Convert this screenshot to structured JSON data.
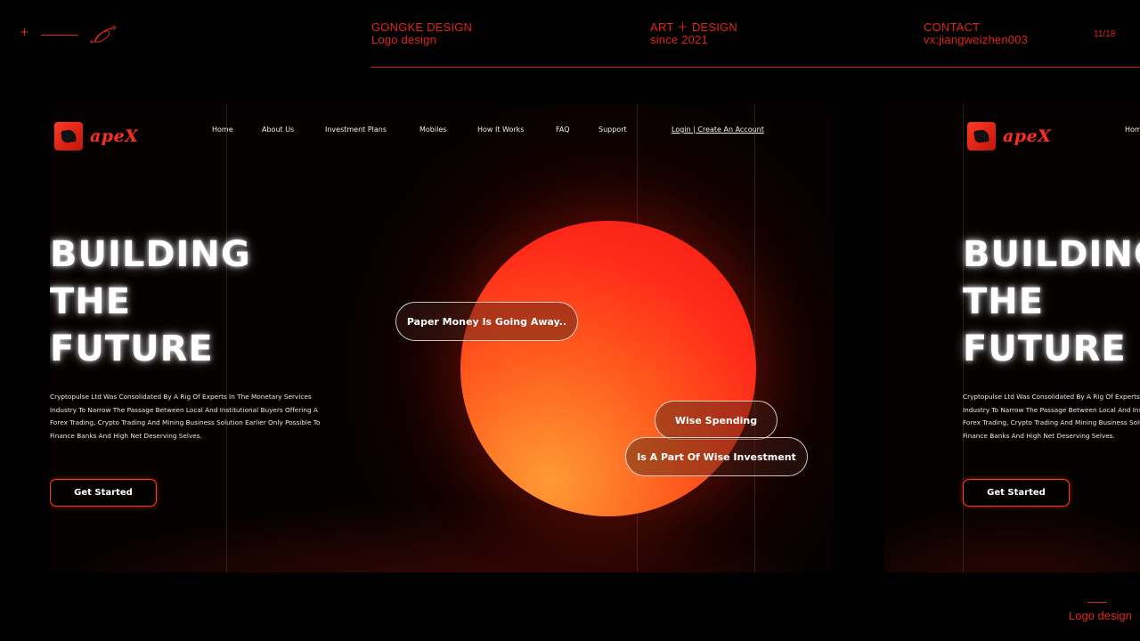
{
  "frame": {
    "col1": {
      "title": "GONGKE DESIGN",
      "subtitle": "Logo design"
    },
    "col2": {
      "title": "ART ＋ DESIGN",
      "subtitle": "since 2021"
    },
    "col3": {
      "title": "CONTACT",
      "subtitle": "vx:jiangweizhen003"
    },
    "page": "11/18",
    "footer": "Logo design",
    "accent": "#e0241c"
  },
  "site": {
    "logo_text": "apeX",
    "nav": {
      "home": "Home",
      "about": "About Us",
      "plans": "Investment Plans",
      "mobiles": "Mobiles",
      "how": "How It Works",
      "faq": "FAQ",
      "support": "Support",
      "login": "Login | Create An Account"
    },
    "hero": {
      "line1": "BUILDING",
      "line2": "THE",
      "line3": "FUTURE"
    },
    "description": "Cryptopulse Ltd Was Consolidated By A Rig Of Experts In The Monetary Services Industry To Narrow The Passage Between Local And Institutional Buyers Offering A Forex Trading, Crypto Trading And Mining Business Solution Earlier Only Possible To Finance Banks And High Net Deserving Selves.",
    "cta": "Get Started",
    "pills": {
      "paper": "Paper Money Is Going Away..",
      "wise": "Wise Spending",
      "invest": "Is A Part Of Wise Investment"
    },
    "brand_color": "#ff2e1c"
  }
}
